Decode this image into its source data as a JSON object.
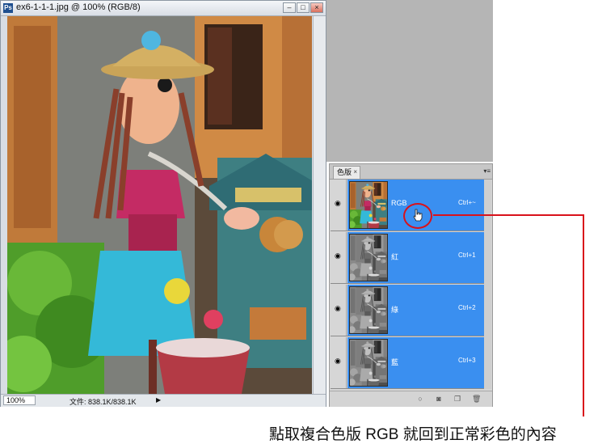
{
  "document": {
    "title": "ex6-1-1-1.jpg @ 100% (RGB/8)",
    "zoom": "100%",
    "info": "文件: 838.1K/838.1K"
  },
  "channels_panel": {
    "tab_label": "色版",
    "channels": [
      {
        "name": "RGB",
        "shortcut": "Ctrl+~",
        "mode": "color"
      },
      {
        "name": "紅",
        "shortcut": "Ctrl+1",
        "mode": "gray"
      },
      {
        "name": "綠",
        "shortcut": "Ctrl+2",
        "mode": "gray"
      },
      {
        "name": "藍",
        "shortcut": "Ctrl+3",
        "mode": "gray"
      }
    ]
  },
  "caption": "點取複合色版 RGB 就回到正常彩色的內容",
  "colors": {
    "accent_red": "#d9121b",
    "selection_blue": "#3a8ff0"
  },
  "icons": [
    "photoshop-app-icon",
    "minimize-icon",
    "maximize-icon",
    "close-icon",
    "eye-icon",
    "hand-cursor-icon",
    "panel-menu-icon",
    "load-selection-icon",
    "save-selection-icon",
    "new-channel-icon",
    "delete-channel-icon"
  ]
}
